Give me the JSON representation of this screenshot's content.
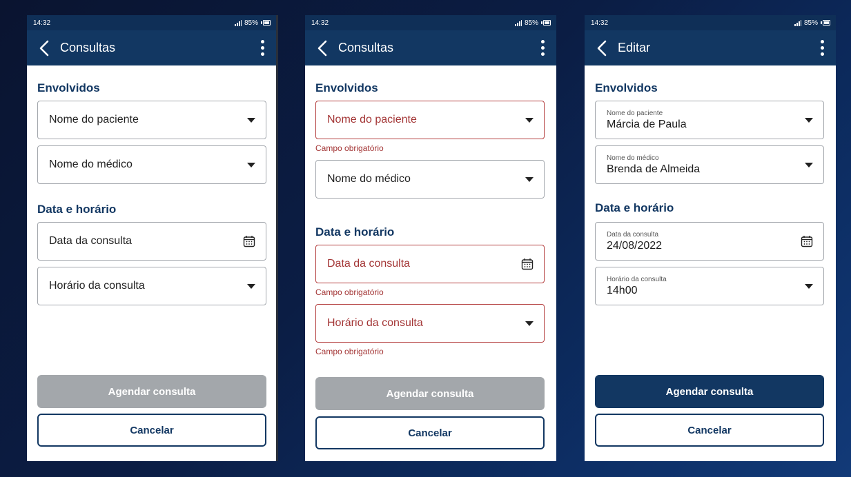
{
  "colors": {
    "primary": "#123762",
    "error": "#a33535",
    "disabled": "#a3a7ab"
  },
  "screens": [
    {
      "status": {
        "time": "14:32",
        "battery": "85%"
      },
      "title": "Consultas",
      "section_involved": "Envolvidos",
      "patient_placeholder": "Nome do paciente",
      "doctor_placeholder": "Nome do médico",
      "section_datetime": "Data e horário",
      "date_placeholder": "Data da consulta",
      "time_placeholder": "Horário da consulta",
      "submit_label": "Agendar consulta",
      "cancel_label": "Cancelar"
    },
    {
      "status": {
        "time": "14:32",
        "battery": "85%"
      },
      "title": "Consultas",
      "section_involved": "Envolvidos",
      "patient_placeholder": "Nome do paciente",
      "required_error": "Campo obrigatório",
      "doctor_placeholder": "Nome do médico",
      "section_datetime": "Data e horário",
      "date_placeholder": "Data da consulta",
      "time_placeholder": "Horário da consulta",
      "submit_label": "Agendar consulta",
      "cancel_label": "Cancelar"
    },
    {
      "status": {
        "time": "14:32",
        "battery": "85%"
      },
      "title": "Editar",
      "section_involved": "Envolvidos",
      "patient_label": "Nome do paciente",
      "patient_value": "Márcia de Paula",
      "doctor_label": "Nome do médico",
      "doctor_value": "Brenda de Almeida",
      "section_datetime": "Data e horário",
      "date_label": "Data da consulta",
      "date_value": "24/08/2022",
      "time_label": "Horário da consulta",
      "time_value": "14h00",
      "submit_label": "Agendar consulta",
      "cancel_label": "Cancelar"
    }
  ]
}
